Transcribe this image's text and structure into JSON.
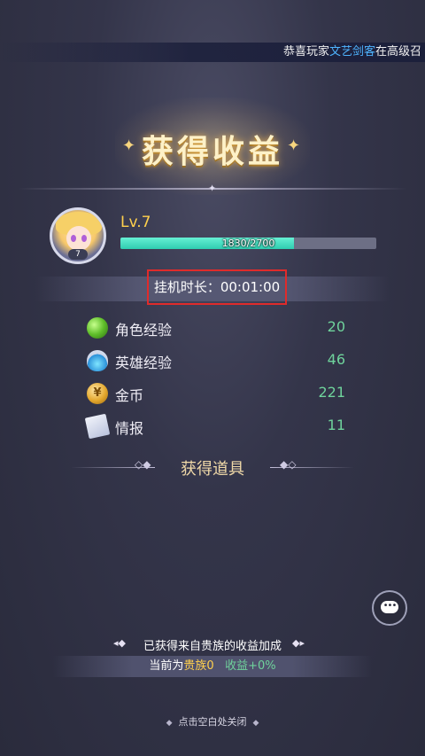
{
  "marquee": {
    "prefix": "恭喜玩家",
    "player_name": "文艺剑客",
    "suffix": "在高级召"
  },
  "title": "获得收益",
  "player": {
    "avatar_badge": "7",
    "level_label": "Lv.7",
    "xp_current": 1830,
    "xp_max": 2700,
    "xp_text": "1830/2700",
    "xp_fraction": 0.678
  },
  "idle_time": {
    "label": "挂机时长：00:01:00"
  },
  "rewards": [
    {
      "name": "角色经验",
      "value": "20",
      "icon": "green-orb-icon"
    },
    {
      "name": "英雄经验",
      "value": "46",
      "icon": "potion-flask-icon"
    },
    {
      "name": "金币",
      "value": "221",
      "icon": "gold-coin-icon"
    },
    {
      "name": "情报",
      "value": "11",
      "icon": "intel-document-icon"
    }
  ],
  "items_header": "获得道具",
  "noble": {
    "header": "已获得来自贵族的收益加成",
    "current_prefix": "当前为",
    "current_rank": "贵族0",
    "bonus": "收益+0%"
  },
  "close_hint": "点击空白处关闭",
  "colors": {
    "accent_gold": "#ffd04d",
    "value_green": "#6fd39c",
    "xp_bar": "#2fcdb0",
    "highlight_box": "#e02b2b",
    "player_name_blue": "#4fb4ff"
  }
}
